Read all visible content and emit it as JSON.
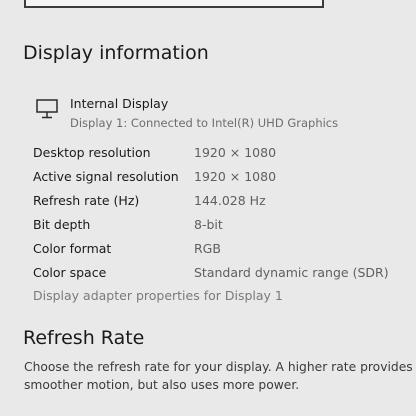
{
  "display_info": {
    "heading": "Display information",
    "display_name": "Internal Display",
    "display_subtitle": "Display 1: Connected to Intel(R) UHD Graphics",
    "rows": [
      {
        "label": "Desktop resolution",
        "value": "1920 × 1080"
      },
      {
        "label": "Active signal resolution",
        "value": "1920 × 1080"
      },
      {
        "label": "Refresh rate (Hz)",
        "value": "144.028 Hz"
      },
      {
        "label": "Bit depth",
        "value": "8-bit"
      },
      {
        "label": "Color format",
        "value": "RGB"
      },
      {
        "label": "Color space",
        "value": "Standard dynamic range (SDR)"
      }
    ],
    "adapter_link": "Display adapter properties for Display 1"
  },
  "refresh_rate": {
    "heading": "Refresh Rate",
    "description": "Choose the refresh rate for your display. A higher rate provides smoother motion, but also uses more power."
  },
  "icons": {
    "monitor": "monitor-icon"
  }
}
